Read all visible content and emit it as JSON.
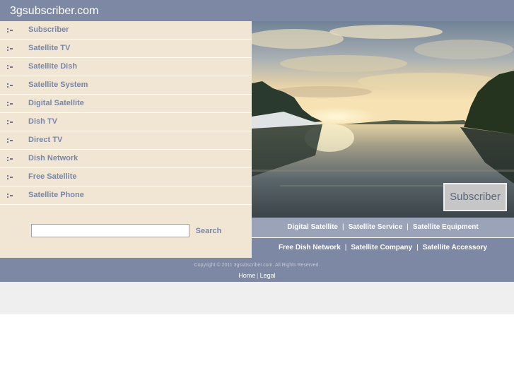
{
  "header": {
    "title": "3gsubscriber.com"
  },
  "sidebar": {
    "items": [
      {
        "label": "Subscriber"
      },
      {
        "label": "Satellite TV"
      },
      {
        "label": "Satellite Dish"
      },
      {
        "label": "Satellite System"
      },
      {
        "label": "Digital Satellite"
      },
      {
        "label": "Dish TV"
      },
      {
        "label": "Direct TV"
      },
      {
        "label": "Dish Network"
      },
      {
        "label": "Free Satellite"
      },
      {
        "label": "Satellite Phone"
      }
    ],
    "bullet_icon": "bullet-icon"
  },
  "search": {
    "value": "",
    "button_label": "Search"
  },
  "hero": {
    "badge": "Subscriber"
  },
  "links": {
    "row1": [
      "Digital Satellite",
      "Satellite Service",
      "Satellite Equipment"
    ],
    "row2": [
      "Free Dish Network",
      "Satellite Company",
      "Satellite Accessory"
    ],
    "separator": "|"
  },
  "footer": {
    "copyright": "Copyright © 2011 3gsubscriber.com. All Rights Reserved.",
    "links": [
      "Home",
      "Legal"
    ],
    "separator": "|"
  },
  "colors": {
    "header": "#7d88a4",
    "sidebar": "#f1e6d4",
    "nav_text": "#7a86a6",
    "links_row_light": "#9aa3b7",
    "bottom_band": "#efefef"
  }
}
